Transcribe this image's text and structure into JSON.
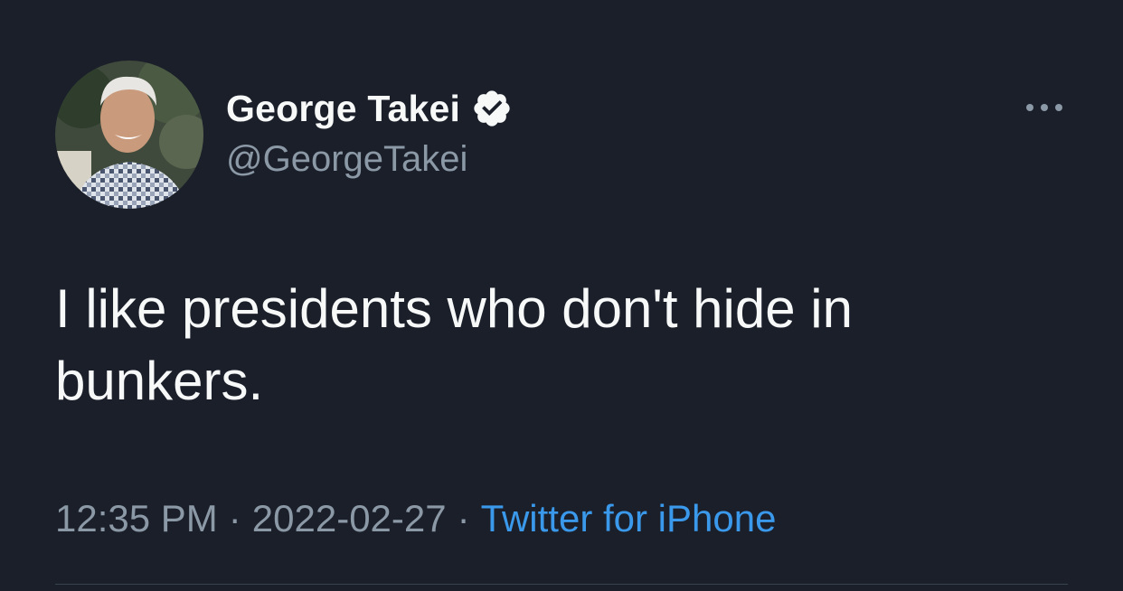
{
  "author": {
    "display_name": "George Takei",
    "handle": "@GeorgeTakei",
    "verified": true
  },
  "tweet": {
    "text": "I like presidents who don't hide in bunkers.",
    "time": "12:35 PM",
    "date": "2022-02-27",
    "separator": "·",
    "source": "Twitter for iPhone"
  },
  "icons": {
    "verified": "verified-badge-icon",
    "more": "more-options-icon"
  },
  "colors": {
    "background": "#1b1f2a",
    "primary_text": "#f7f9f9",
    "secondary_text": "#8b98a5",
    "link": "#3b99eb"
  }
}
